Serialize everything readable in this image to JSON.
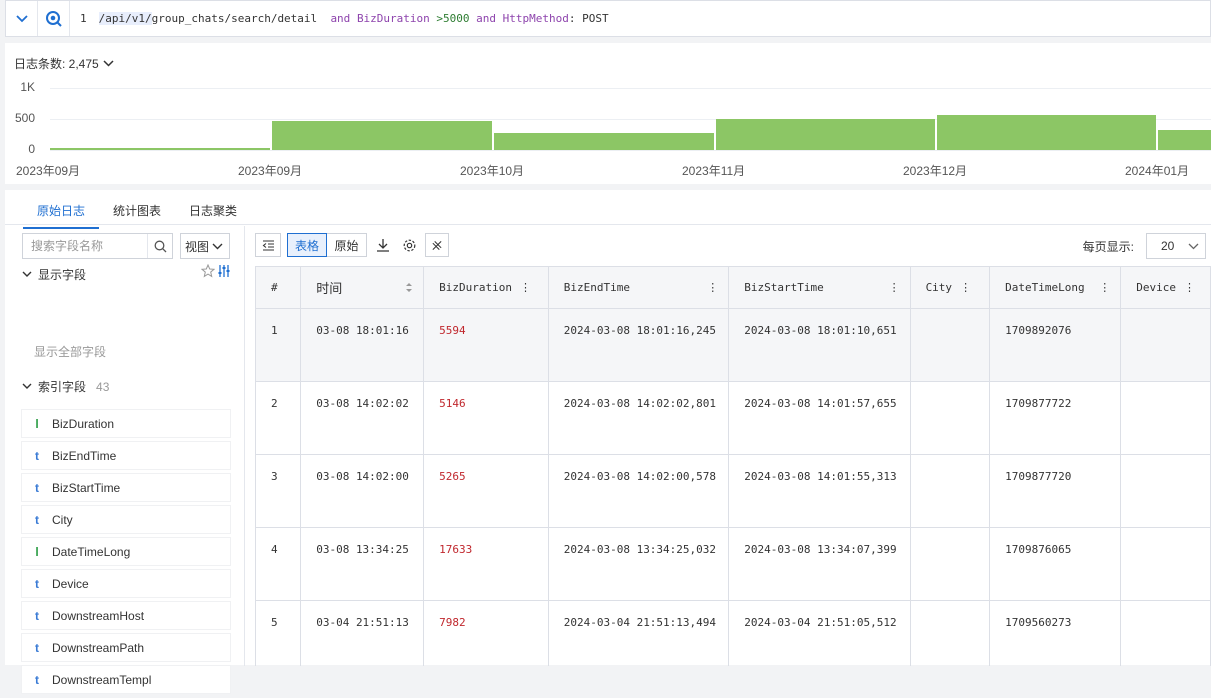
{
  "query": {
    "line_number": "1",
    "path_hl": "/api/v1/",
    "path_rest": "group_chats/search/detail",
    "and1": "and",
    "field1": "BizDuration",
    "op1": ">5000",
    "and2": "and",
    "field2": "HttpMethod",
    "op2": ": POST"
  },
  "histogram": {
    "title": "日志条数: 2,475",
    "chart_data": {
      "type": "bar",
      "title": "",
      "y_ticks": [
        "1K",
        "500",
        "0"
      ],
      "ylim": [
        0,
        1000
      ],
      "x_ticks": [
        "2023年09月",
        "2023年09月",
        "2023年10月",
        "2023年11月",
        "2023年12月",
        "2024年01月"
      ],
      "values": [
        20,
        460,
        270,
        500,
        570,
        330
      ],
      "color": "#8cc665"
    }
  },
  "tabs": [
    {
      "label": "原始日志",
      "active": true
    },
    {
      "label": "统计图表",
      "active": false
    },
    {
      "label": "日志聚类",
      "active": false
    }
  ],
  "sidebar": {
    "search_placeholder": "搜索字段名称",
    "view_label": "视图",
    "display_section": "显示字段",
    "show_all": "显示全部字段",
    "index_section": "索引字段",
    "index_count": "43",
    "fields": [
      {
        "type": "l",
        "name": "BizDuration"
      },
      {
        "type": "t",
        "name": "BizEndTime"
      },
      {
        "type": "t",
        "name": "BizStartTime"
      },
      {
        "type": "t",
        "name": "City"
      },
      {
        "type": "l",
        "name": "DateTimeLong"
      },
      {
        "type": "t",
        "name": "Device"
      },
      {
        "type": "t",
        "name": "DownstreamHost"
      },
      {
        "type": "t",
        "name": "DownstreamPath"
      },
      {
        "type": "t",
        "name": "DownstreamTempl"
      }
    ]
  },
  "toolbar": {
    "table_label": "表格",
    "raw_label": "原始",
    "per_page_label": "每页显示:",
    "per_page_value": "20"
  },
  "table": {
    "columns": [
      "#",
      "时间",
      "BizDuration",
      "BizEndTime",
      "BizStartTime",
      "City",
      "DateTimeLong",
      "Device"
    ],
    "rows": [
      [
        "1",
        "03-08 18:01:16",
        "5594",
        "2024-03-08 18:01:16,245",
        "2024-03-08 18:01:10,651",
        "",
        "1709892076",
        ""
      ],
      [
        "2",
        "03-08 14:02:02",
        "5146",
        "2024-03-08 14:02:02,801",
        "2024-03-08 14:01:57,655",
        "",
        "1709877722",
        ""
      ],
      [
        "3",
        "03-08 14:02:00",
        "5265",
        "2024-03-08 14:02:00,578",
        "2024-03-08 14:01:55,313",
        "",
        "1709877720",
        ""
      ],
      [
        "4",
        "03-08 13:34:25",
        "17633",
        "2024-03-08 13:34:25,032",
        "2024-03-08 13:34:07,399",
        "",
        "1709876065",
        ""
      ],
      [
        "5",
        "03-04 21:51:13",
        "7982",
        "2024-03-04 21:51:13,494",
        "2024-03-04 21:51:05,512",
        "",
        "1709560273",
        ""
      ]
    ]
  }
}
